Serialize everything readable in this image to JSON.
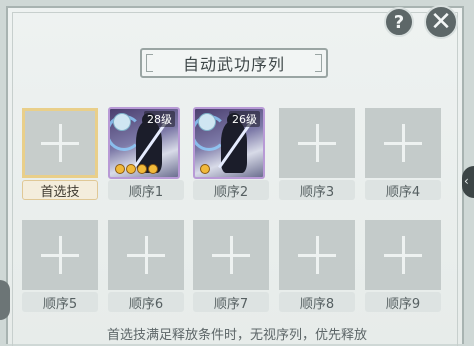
{
  "window": {
    "title": "自动武功序列",
    "help_label": "?",
    "close_label": "✕"
  },
  "slots": [
    {
      "label": "首选技",
      "state": "empty",
      "selected": true
    },
    {
      "label": "顺序1",
      "state": "skill",
      "level": "28级",
      "stars": 4,
      "icon": "swordsman-skill-icon"
    },
    {
      "label": "顺序2",
      "state": "skill",
      "level": "26级",
      "stars": 1,
      "icon": "swordsman-skill-icon"
    },
    {
      "label": "顺序3",
      "state": "empty"
    },
    {
      "label": "顺序4",
      "state": "empty"
    },
    {
      "label": "顺序5",
      "state": "empty"
    },
    {
      "label": "顺序6",
      "state": "empty"
    },
    {
      "label": "顺序7",
      "state": "empty"
    },
    {
      "label": "顺序8",
      "state": "empty"
    },
    {
      "label": "顺序9",
      "state": "empty"
    }
  ],
  "footer": {
    "note": "首选技满足释放条件时，无视序列，优先释放"
  },
  "colors": {
    "panel_bg": "#eef2f1",
    "slot_bg": "#c4cbca",
    "selected_border": "#e9cf8a",
    "skill_border": "#b89ad6",
    "star": "#f1b93a"
  }
}
